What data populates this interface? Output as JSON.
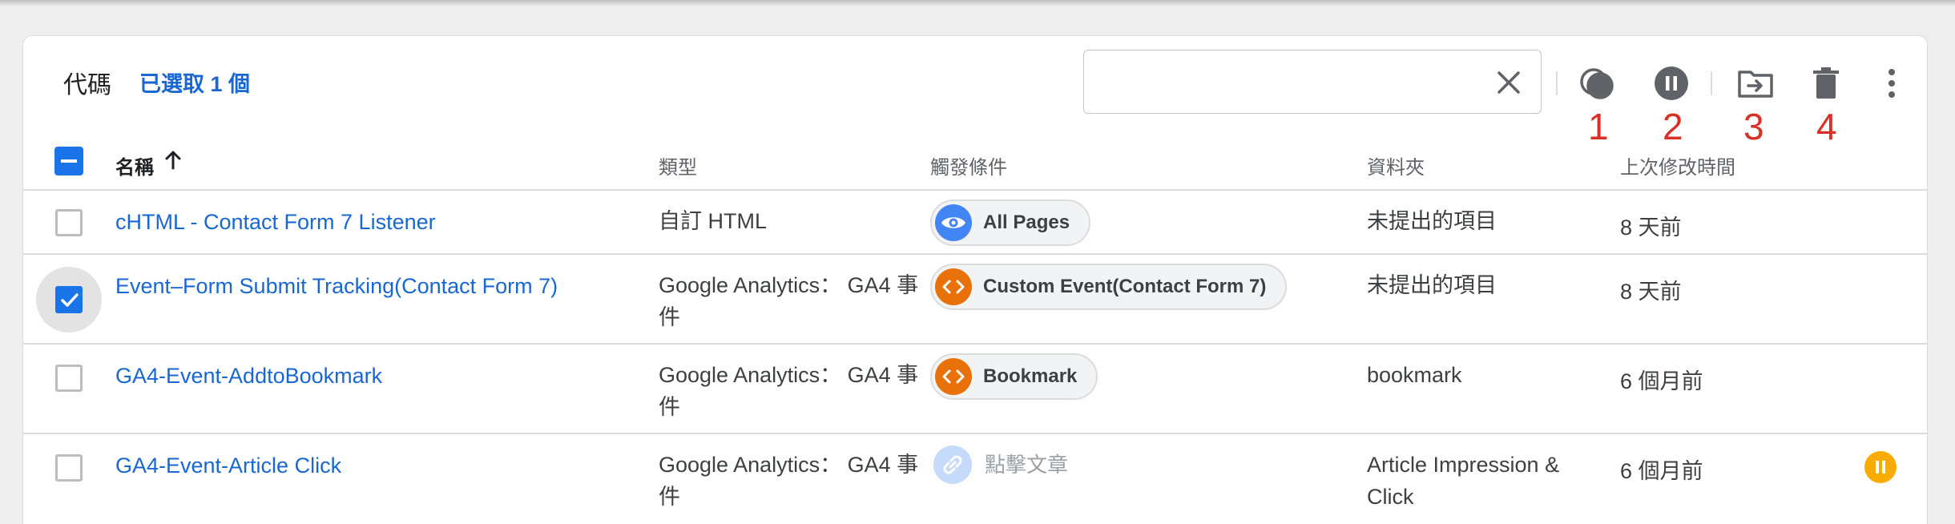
{
  "header": {
    "title": "代碼",
    "selected_count": "已選取 1 個",
    "search": {
      "value": "",
      "placeholder": ""
    }
  },
  "toolbar": {
    "buttons": [
      {
        "icon": "merge-icon",
        "annotation": "1"
      },
      {
        "icon": "pause-icon",
        "annotation": "2"
      },
      {
        "icon": "move-to-folder-icon",
        "annotation": "3"
      },
      {
        "icon": "delete-icon",
        "annotation": "4"
      },
      {
        "icon": "more-vert-icon",
        "annotation": ""
      }
    ]
  },
  "columns": {
    "name": "名稱",
    "type": "類型",
    "trigger": "觸發條件",
    "folder": "資料夾",
    "modified": "上次修改時間"
  },
  "rows": [
    {
      "name": "cHTML - Contact Form 7 Listener",
      "type": "自訂 HTML",
      "trigger": "All Pages",
      "trigger_icon": "eye-icon",
      "trigger_color": "#4285f4",
      "folder": "未提出的項目",
      "modified": "8 天前",
      "checked": false
    },
    {
      "name": "Event–Form Submit Tracking(Contact Form 7)",
      "type": "Google Analytics： GA4 事件",
      "trigger": "Custom Event(Contact Form 7)",
      "trigger_icon": "code-icon",
      "trigger_color": "#e8710a",
      "folder": "未提出的項目",
      "modified": "8 天前",
      "checked": true
    },
    {
      "name": "GA4-Event-AddtoBookmark",
      "type": "Google Analytics： GA4 事件",
      "trigger": "Bookmark",
      "trigger_icon": "code-icon",
      "trigger_color": "#e8710a",
      "folder": "bookmark",
      "modified": "6 個月前",
      "checked": false
    },
    {
      "name": "GA4-Event-Article Click",
      "type": "Google Analytics： GA4 事件",
      "trigger": "點擊文章",
      "trigger_icon": "link-icon",
      "trigger_color": "#c6dafc",
      "folder": "Article Impression & Click",
      "modified": "6 個月前",
      "checked": false,
      "paused": true
    }
  ],
  "colors": {
    "accent": "#1a73e8",
    "link": "#1967d2",
    "annotation": "#d93025",
    "paused": "#f9ab00"
  }
}
